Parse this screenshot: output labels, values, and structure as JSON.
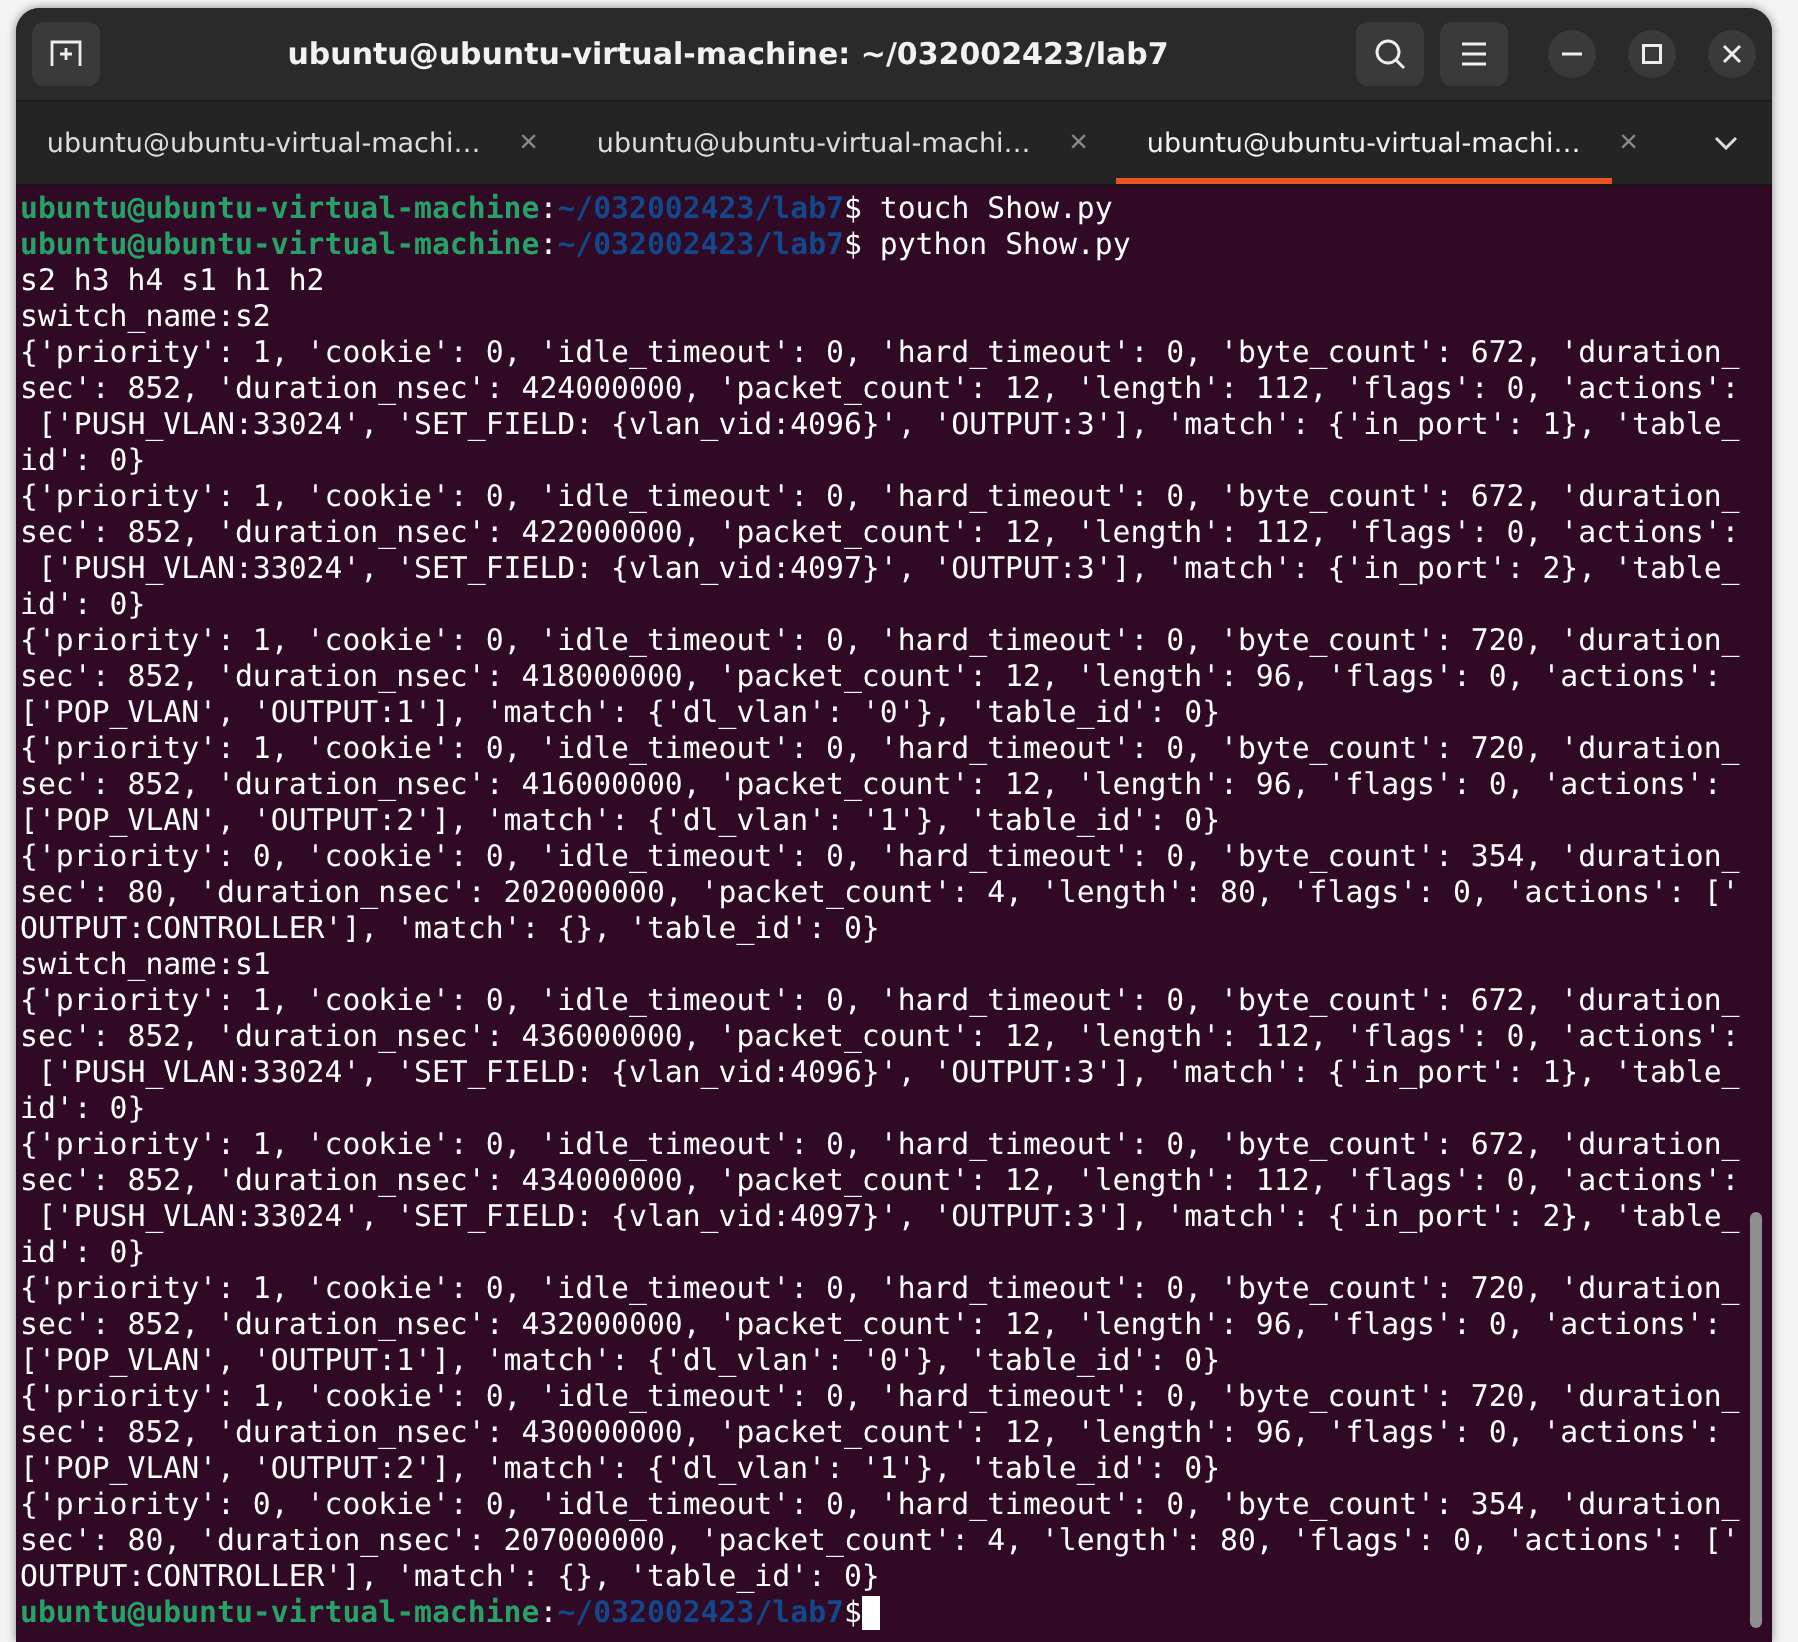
{
  "window": {
    "title": "ubuntu@ubuntu-virtual-machine: ~/032002423/lab7"
  },
  "tabs": [
    {
      "label": "ubuntu@ubuntu-virtual-machi…",
      "selected": false
    },
    {
      "label": "ubuntu@ubuntu-virtual-machi…",
      "selected": false
    },
    {
      "label": "ubuntu@ubuntu-virtual-machi…",
      "selected": true
    }
  ],
  "tab_close_glyph": "×",
  "terminal": {
    "lines": [
      {
        "kind": "prompt",
        "user_host": "ubuntu@ubuntu-virtual-machine",
        "path": "~/032002423/lab7",
        "separator": ":",
        "command": "$ touch Show.py",
        "cursor": false
      },
      {
        "kind": "prompt",
        "user_host": "ubuntu@ubuntu-virtual-machine",
        "path": "~/032002423/lab7",
        "separator": ":",
        "command": "$ python Show.py",
        "cursor": false
      },
      {
        "kind": "output",
        "text": "s2 h3 h4 s1 h1 h2"
      },
      {
        "kind": "output",
        "text": "switch_name:s2"
      },
      {
        "kind": "output",
        "text": "{'priority': 1, 'cookie': 0, 'idle_timeout': 0, 'hard_timeout': 0, 'byte_count': 672, 'duration_"
      },
      {
        "kind": "output",
        "text": "sec': 852, 'duration_nsec': 424000000, 'packet_count': 12, 'length': 112, 'flags': 0, 'actions':"
      },
      {
        "kind": "output",
        "text": " ['PUSH_VLAN:33024', 'SET_FIELD: {vlan_vid:4096}', 'OUTPUT:3'], 'match': {'in_port': 1}, 'table_"
      },
      {
        "kind": "output",
        "text": "id': 0}"
      },
      {
        "kind": "output",
        "text": "{'priority': 1, 'cookie': 0, 'idle_timeout': 0, 'hard_timeout': 0, 'byte_count': 672, 'duration_"
      },
      {
        "kind": "output",
        "text": "sec': 852, 'duration_nsec': 422000000, 'packet_count': 12, 'length': 112, 'flags': 0, 'actions':"
      },
      {
        "kind": "output",
        "text": " ['PUSH_VLAN:33024', 'SET_FIELD: {vlan_vid:4097}', 'OUTPUT:3'], 'match': {'in_port': 2}, 'table_"
      },
      {
        "kind": "output",
        "text": "id': 0}"
      },
      {
        "kind": "output",
        "text": "{'priority': 1, 'cookie': 0, 'idle_timeout': 0, 'hard_timeout': 0, 'byte_count': 720, 'duration_"
      },
      {
        "kind": "output",
        "text": "sec': 852, 'duration_nsec': 418000000, 'packet_count': 12, 'length': 96, 'flags': 0, 'actions':"
      },
      {
        "kind": "output",
        "text": "['POP_VLAN', 'OUTPUT:1'], 'match': {'dl_vlan': '0'}, 'table_id': 0}"
      },
      {
        "kind": "output",
        "text": "{'priority': 1, 'cookie': 0, 'idle_timeout': 0, 'hard_timeout': 0, 'byte_count': 720, 'duration_"
      },
      {
        "kind": "output",
        "text": "sec': 852, 'duration_nsec': 416000000, 'packet_count': 12, 'length': 96, 'flags': 0, 'actions':"
      },
      {
        "kind": "output",
        "text": "['POP_VLAN', 'OUTPUT:2'], 'match': {'dl_vlan': '1'}, 'table_id': 0}"
      },
      {
        "kind": "output",
        "text": "{'priority': 0, 'cookie': 0, 'idle_timeout': 0, 'hard_timeout': 0, 'byte_count': 354, 'duration_"
      },
      {
        "kind": "output",
        "text": "sec': 80, 'duration_nsec': 202000000, 'packet_count': 4, 'length': 80, 'flags': 0, 'actions': ['"
      },
      {
        "kind": "output",
        "text": "OUTPUT:CONTROLLER'], 'match': {}, 'table_id': 0}"
      },
      {
        "kind": "output",
        "text": "switch_name:s1"
      },
      {
        "kind": "output",
        "text": "{'priority': 1, 'cookie': 0, 'idle_timeout': 0, 'hard_timeout': 0, 'byte_count': 672, 'duration_"
      },
      {
        "kind": "output",
        "text": "sec': 852, 'duration_nsec': 436000000, 'packet_count': 12, 'length': 112, 'flags': 0, 'actions':"
      },
      {
        "kind": "output",
        "text": " ['PUSH_VLAN:33024', 'SET_FIELD: {vlan_vid:4096}', 'OUTPUT:3'], 'match': {'in_port': 1}, 'table_"
      },
      {
        "kind": "output",
        "text": "id': 0}"
      },
      {
        "kind": "output",
        "text": "{'priority': 1, 'cookie': 0, 'idle_timeout': 0, 'hard_timeout': 0, 'byte_count': 672, 'duration_"
      },
      {
        "kind": "output",
        "text": "sec': 852, 'duration_nsec': 434000000, 'packet_count': 12, 'length': 112, 'flags': 0, 'actions':"
      },
      {
        "kind": "output",
        "text": " ['PUSH_VLAN:33024', 'SET_FIELD: {vlan_vid:4097}', 'OUTPUT:3'], 'match': {'in_port': 2}, 'table_"
      },
      {
        "kind": "output",
        "text": "id': 0}"
      },
      {
        "kind": "output",
        "text": "{'priority': 1, 'cookie': 0, 'idle_timeout': 0, 'hard_timeout': 0, 'byte_count': 720, 'duration_"
      },
      {
        "kind": "output",
        "text": "sec': 852, 'duration_nsec': 432000000, 'packet_count': 12, 'length': 96, 'flags': 0, 'actions':"
      },
      {
        "kind": "output",
        "text": "['POP_VLAN', 'OUTPUT:1'], 'match': {'dl_vlan': '0'}, 'table_id': 0}"
      },
      {
        "kind": "output",
        "text": "{'priority': 1, 'cookie': 0, 'idle_timeout': 0, 'hard_timeout': 0, 'byte_count': 720, 'duration_"
      },
      {
        "kind": "output",
        "text": "sec': 852, 'duration_nsec': 430000000, 'packet_count': 12, 'length': 96, 'flags': 0, 'actions':"
      },
      {
        "kind": "output",
        "text": "['POP_VLAN', 'OUTPUT:2'], 'match': {'dl_vlan': '1'}, 'table_id': 0}"
      },
      {
        "kind": "output",
        "text": "{'priority': 0, 'cookie': 0, 'idle_timeout': 0, 'hard_timeout': 0, 'byte_count': 354, 'duration_"
      },
      {
        "kind": "output",
        "text": "sec': 80, 'duration_nsec': 207000000, 'packet_count': 4, 'length': 80, 'flags': 0, 'actions': ['"
      },
      {
        "kind": "output",
        "text": "OUTPUT:CONTROLLER'], 'match': {}, 'table_id': 0}"
      },
      {
        "kind": "prompt",
        "user_host": "ubuntu@ubuntu-virtual-machine",
        "path": "~/032002423/lab7",
        "separator": ":",
        "command": "$",
        "cursor": true
      }
    ]
  }
}
